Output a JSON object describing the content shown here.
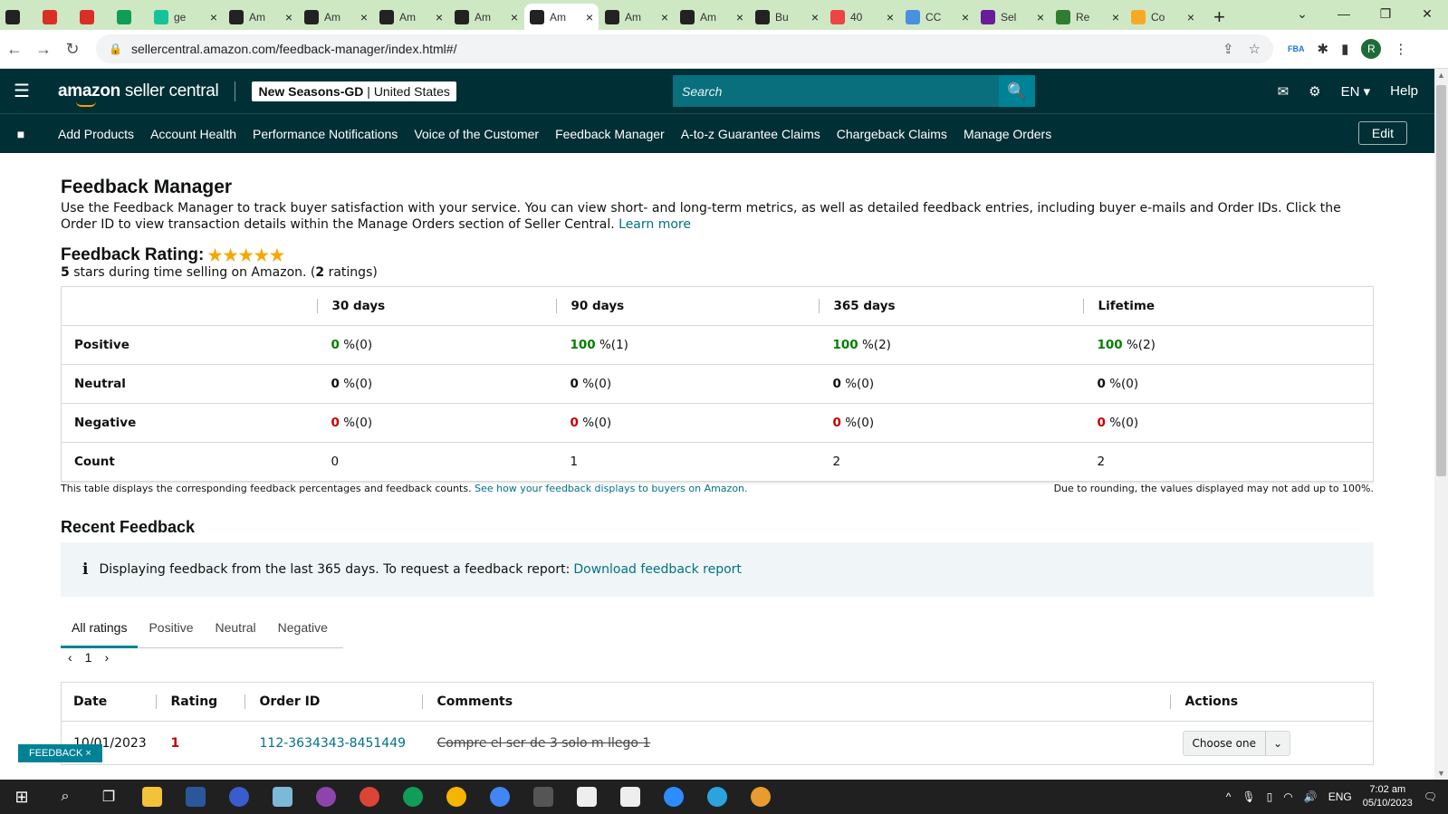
{
  "browser": {
    "tabs": [
      {
        "title": "",
        "icon": "amazon-a",
        "color": "#222"
      },
      {
        "title": "",
        "icon": "gmail",
        "color": "#d93025"
      },
      {
        "title": "",
        "icon": "gmail",
        "color": "#d93025"
      },
      {
        "title": "",
        "icon": "sheets",
        "color": "#0f9d58"
      },
      {
        "title": "ge",
        "icon": "grammarly",
        "color": "#15c39a"
      },
      {
        "title": "Am",
        "icon": "amazon-a",
        "color": "#222"
      },
      {
        "title": "Am",
        "icon": "amazon-a",
        "color": "#222"
      },
      {
        "title": "Am",
        "icon": "amazon-a",
        "color": "#222"
      },
      {
        "title": "Am",
        "icon": "amazon-a",
        "color": "#222"
      },
      {
        "title": "Am",
        "icon": "amazon-a",
        "color": "#222",
        "active": true
      },
      {
        "title": "Am",
        "icon": "amazon-a",
        "color": "#222"
      },
      {
        "title": "Am",
        "icon": "amazon-a",
        "color": "#222"
      },
      {
        "title": "Bu",
        "icon": "amazon-a",
        "color": "#222"
      },
      {
        "title": "40",
        "icon": "shop",
        "color": "#e44"
      },
      {
        "title": "CC",
        "icon": "globe",
        "color": "#4a90e2"
      },
      {
        "title": "Sel",
        "icon": "sn",
        "color": "#6a1b9a"
      },
      {
        "title": "Re",
        "icon": "leaf",
        "color": "#2e7d32"
      },
      {
        "title": "Co",
        "icon": "tool",
        "color": "#f9a825"
      }
    ],
    "new_tab": "+",
    "url": "sellercentral.amazon.com/feedback-manager/index.html#/"
  },
  "header": {
    "brand_main": "amazon",
    "brand_sub": " seller central",
    "account_name": "New Seasons-GD",
    "account_sep": " | ",
    "account_region": "United States",
    "search_placeholder": "Search",
    "language": "EN",
    "help": "Help"
  },
  "nav": {
    "items": [
      "Add Products",
      "Account Health",
      "Performance Notifications",
      "Voice of the Customer",
      "Feedback Manager",
      "A-to-z Guarantee Claims",
      "Chargeback Claims",
      "Manage Orders"
    ],
    "edit": "Edit"
  },
  "page": {
    "title": "Feedback Manager",
    "description": "Use the Feedback Manager to track buyer satisfaction with your service. You can view short- and long-term metrics, as well as detailed feedback entries, including buyer e-mails and Order IDs. Click the Order ID to view transaction details within the Manage Orders section of Seller Central. ",
    "learn_more": "Learn more",
    "rating_label": "Feedback Rating:",
    "stars": "★★★★★",
    "rating_stars_count": "5",
    "rating_text_a": " stars during time selling on Amazon. (",
    "rating_count": "2",
    "rating_text_b": " ratings)"
  },
  "feedback_table": {
    "columns": [
      "30 days",
      "90 days",
      "365 days",
      "Lifetime"
    ],
    "rows": [
      {
        "label": "Positive",
        "cells": [
          {
            "pct": "0",
            "rest": " %(0)"
          },
          {
            "pct": "100",
            "rest": " %(1)"
          },
          {
            "pct": "100",
            "rest": " %(2)"
          },
          {
            "pct": "100",
            "rest": " %(2)"
          }
        ]
      },
      {
        "label": "Neutral",
        "cells": [
          {
            "pct": "0",
            "rest": " %(0)"
          },
          {
            "pct": "0",
            "rest": " %(0)"
          },
          {
            "pct": "0",
            "rest": " %(0)"
          },
          {
            "pct": "0",
            "rest": " %(0)"
          }
        ]
      },
      {
        "label": "Negative",
        "cells": [
          {
            "pct": "0",
            "rest": " %(0)"
          },
          {
            "pct": "0",
            "rest": " %(0)"
          },
          {
            "pct": "0",
            "rest": " %(0)"
          },
          {
            "pct": "0",
            "rest": " %(0)"
          }
        ]
      },
      {
        "label": "Count",
        "cells": [
          {
            "pct": "0",
            "rest": ""
          },
          {
            "pct": "1",
            "rest": ""
          },
          {
            "pct": "2",
            "rest": ""
          },
          {
            "pct": "2",
            "rest": ""
          }
        ]
      }
    ],
    "note_left": "This table displays the corresponding feedback percentages and feedback counts. ",
    "note_link": "See how your feedback displays to buyers on Amazon.",
    "note_right": "Due to rounding, the values displayed may not add up to 100%."
  },
  "recent": {
    "title": "Recent Feedback",
    "info_text": "Displaying feedback from the last 365 days. To request a feedback report: ",
    "info_link": "Download feedback report",
    "tabs": [
      "All ratings",
      "Positive",
      "Neutral",
      "Negative"
    ],
    "page": "1",
    "columns": [
      "Date",
      "Rating",
      "Order ID",
      "Comments",
      "Actions"
    ],
    "rows": [
      {
        "date": "10/01/2023",
        "rating": "1",
        "order_id": "112-3634343-8451449",
        "comment": "Compre el ser de 3 solo m llego 1",
        "action": "Choose one"
      }
    ]
  },
  "feedback_tag": "FEEDBACK ×",
  "tray": {
    "lang": "ENG",
    "time": "7:02 am",
    "date": "05/10/2023"
  },
  "colors": {
    "header_bg": "#002f36",
    "search_bg": "#096f7d",
    "link": "#007185",
    "positive": "#067d00",
    "negative": "#c40000",
    "star": "#f7a700"
  }
}
